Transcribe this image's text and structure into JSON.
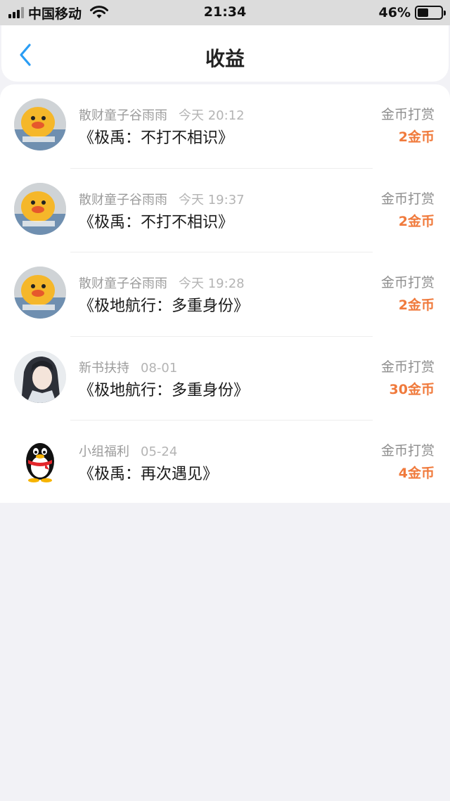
{
  "status_bar": {
    "carrier": "中国移动",
    "time": "21:34",
    "battery_percent": "46%",
    "battery_level": 0.46
  },
  "nav": {
    "back_icon": "chevron-left-icon",
    "title": "收益"
  },
  "colors": {
    "accent": "#2a9df4",
    "reward": "#f07a3c"
  },
  "items": [
    {
      "sender": "散财童子谷雨雨",
      "time": "今天 20:12",
      "book": "《极禹：不打不相识》",
      "type": "金币打赏",
      "amount": "2金币",
      "avatar": "duck-avatar"
    },
    {
      "sender": "散财童子谷雨雨",
      "time": "今天 19:37",
      "book": "《极禹：不打不相识》",
      "type": "金币打赏",
      "amount": "2金币",
      "avatar": "duck-avatar"
    },
    {
      "sender": "散财童子谷雨雨",
      "time": "今天 19:28",
      "book": "《极地航行：多重身份》",
      "type": "金币打赏",
      "amount": "2金币",
      "avatar": "duck-avatar"
    },
    {
      "sender": "新书扶持",
      "time": "08-01",
      "book": "《极地航行：多重身份》",
      "type": "金币打赏",
      "amount": "30金币",
      "avatar": "anime-avatar"
    },
    {
      "sender": "小组福利",
      "time": "05-24",
      "book": "《极禹：再次遇见》",
      "type": "金币打赏",
      "amount": "4金币",
      "avatar": "penguin-avatar"
    }
  ]
}
